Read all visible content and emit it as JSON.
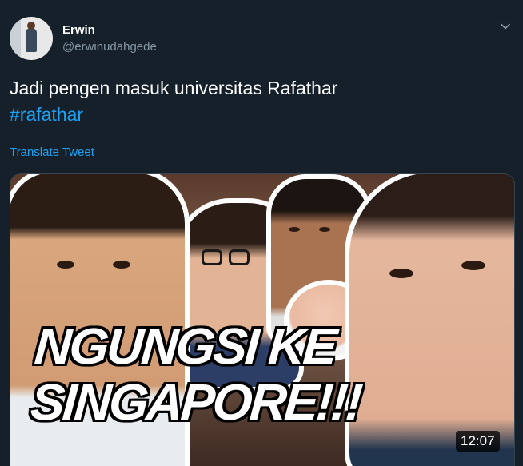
{
  "author": {
    "name": "Erwin",
    "handle": "@erwinudahgede"
  },
  "tweet": {
    "text": "Jadi pengen masuk universitas Rafathar",
    "hashtag": "#rafathar",
    "translate_label": "Translate Tweet"
  },
  "media": {
    "thumbnail_title": "NGUNGSI KE\nSINGAPORE!!!",
    "duration": "12:07"
  },
  "icons": {
    "menu": "chevron-down-icon"
  },
  "colors": {
    "background": "#15202b",
    "text": "#ffffff",
    "secondary_text": "#8899a6",
    "accent": "#1da1f2",
    "border": "#38444d"
  }
}
